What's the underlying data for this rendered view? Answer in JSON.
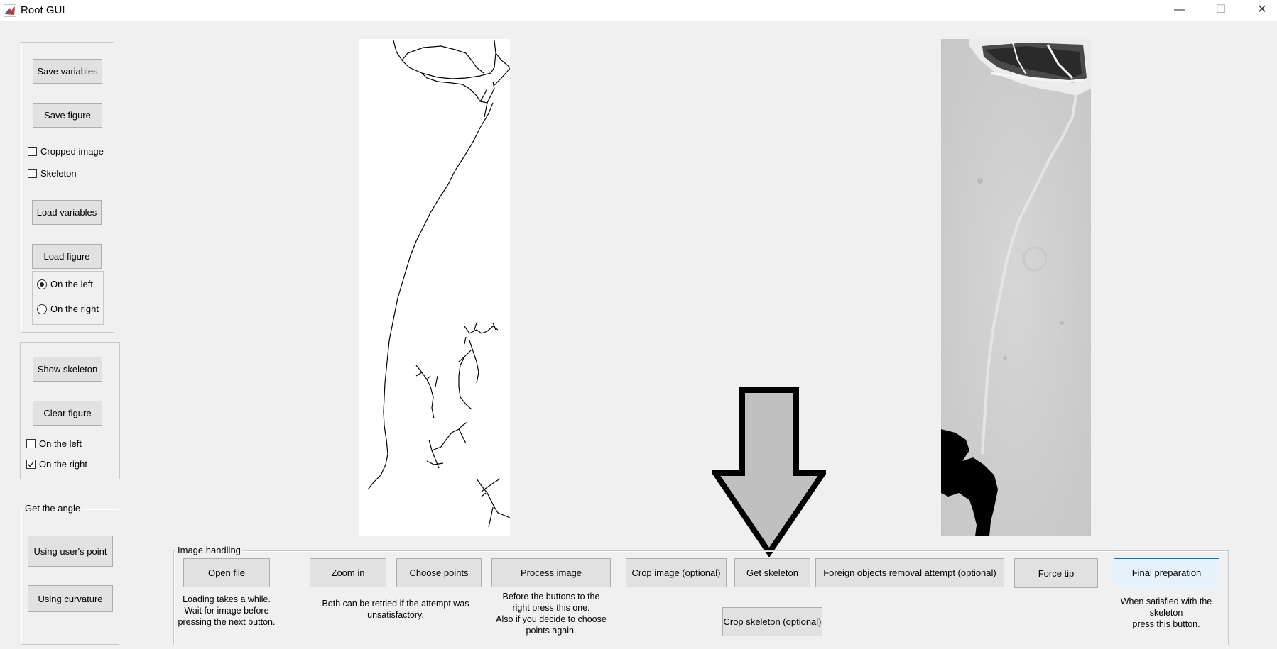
{
  "window": {
    "title": "Root GUI",
    "minimize": "—",
    "maximize": "☐",
    "close": "✕"
  },
  "left_panel": {
    "save_variables": "Save variables",
    "save_figure": "Save figure",
    "cropped_image": "Cropped image",
    "skeleton": "Skeleton",
    "load_variables": "Load variables",
    "load_figure": "Load figure",
    "radio_left": "On the left",
    "radio_right": "On the right",
    "radio_selected": "left"
  },
  "skeleton_panel": {
    "show_skeleton": "Show skeleton",
    "clear_figure": "Clear figure",
    "on_left": "On the left",
    "on_right": "On the right",
    "on_left_checked": false,
    "on_right_checked": true
  },
  "angle_panel": {
    "title": "Get the angle",
    "using_point": "Using user's point",
    "using_curvature": "Using curvature"
  },
  "image_handling": {
    "title": "Image handling",
    "open_file": "Open file",
    "open_note_1": "Loading takes a while.",
    "open_note_2": "Wait for  image before",
    "open_note_3": "pressing the next button.",
    "zoom_in": "Zoom in",
    "choose_points": "Choose points",
    "retry_note_1": "Both can be retried if the attempt was",
    "retry_note_2": "unsatisfactory.",
    "process_image": "Process image",
    "process_note_1": "Before the buttons to the",
    "process_note_2": "right press this one.",
    "process_note_3": "Also if you decide to choose",
    "process_note_4": "points again.",
    "crop_image": "Crop image (optional)",
    "get_skeleton": "Get skeleton",
    "crop_skeleton": "Crop skeleton (optional)",
    "foreign_objects": "Foreign objects removal attempt (optional)",
    "force_tip": "Force tip",
    "final_preparation": "Final preparation",
    "final_note_1": "When satisfied with the",
    "final_note_2": "skeleton",
    "final_note_3": "press this button."
  },
  "icons": {
    "arrow": "down-arrow-icon",
    "app": "matlab-icon"
  }
}
